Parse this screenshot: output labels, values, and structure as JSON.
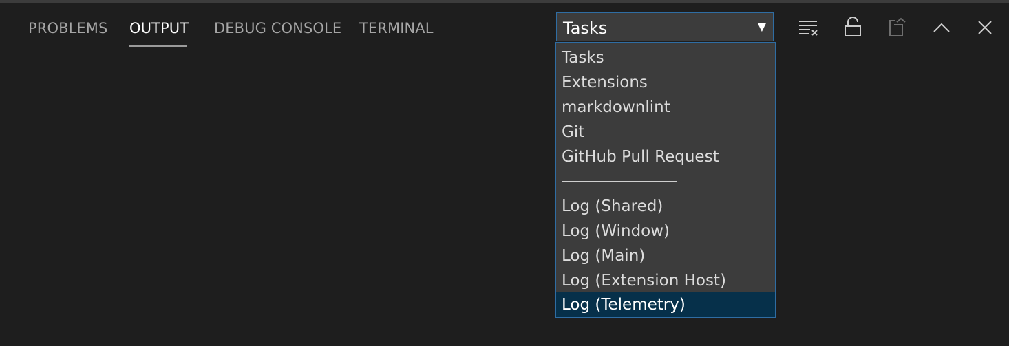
{
  "tabs": [
    {
      "label": "PROBLEMS",
      "active": false
    },
    {
      "label": "OUTPUT",
      "active": true
    },
    {
      "label": "DEBUG CONSOLE",
      "active": false
    },
    {
      "label": "TERMINAL",
      "active": false
    }
  ],
  "output_select": {
    "selected_value": "Tasks",
    "arrow": "▼",
    "options": [
      "Tasks",
      "Extensions",
      "markdownlint",
      "Git",
      "GitHub Pull Request",
      "Log (Shared)",
      "Log (Window)",
      "Log (Main)",
      "Log (Extension Host)",
      "Log (Telemetry)"
    ],
    "highlighted_option": "Log (Telemetry)"
  },
  "toolbar": {
    "icons": [
      "clear-output-icon",
      "lock-scroll-icon",
      "open-log-file-icon",
      "maximize-panel-icon",
      "close-panel-icon"
    ]
  },
  "colors": {
    "background": "#1e1e1e",
    "dropdown_bg": "#3c3c3c",
    "focus_border": "#2f6da3",
    "selected_option_bg": "#06304a",
    "inactive_tab": "#a6a6a6",
    "active_tab": "#ffffff"
  }
}
